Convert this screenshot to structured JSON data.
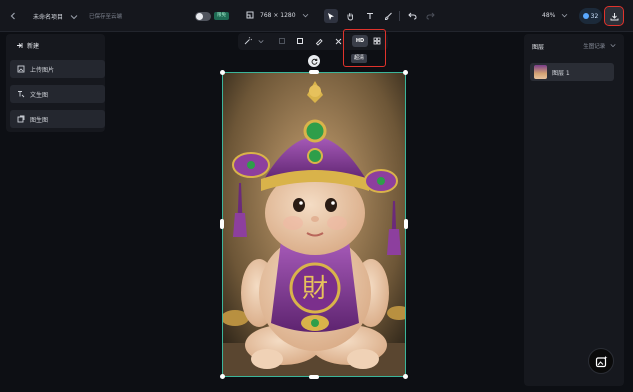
{
  "topbar": {
    "back_icon": "chevron-left-icon",
    "project_name": "未命名项目",
    "save_status": "已保存至云端",
    "beta_badge": "限免",
    "canvas_size": "768 × 1280",
    "zoom": "48%",
    "credits": "32"
  },
  "left_panel": {
    "new_label": "新建",
    "buttons": [
      {
        "label": "上传图片",
        "icon": "image-upload-icon"
      },
      {
        "label": "文生图",
        "icon": "text-to-image-icon"
      },
      {
        "label": "图生图",
        "icon": "image-to-image-icon"
      }
    ]
  },
  "float_toolbar": {
    "hd_label": "HD",
    "hd_tooltip": "超清"
  },
  "right_panel": {
    "title": "图层",
    "history": "生图记录",
    "layers": [
      {
        "name": "图层 1"
      }
    ]
  },
  "colors": {
    "selection": "#3bb59a",
    "highlight": "#e0332c",
    "accent_blue": "#5aa9ff"
  }
}
